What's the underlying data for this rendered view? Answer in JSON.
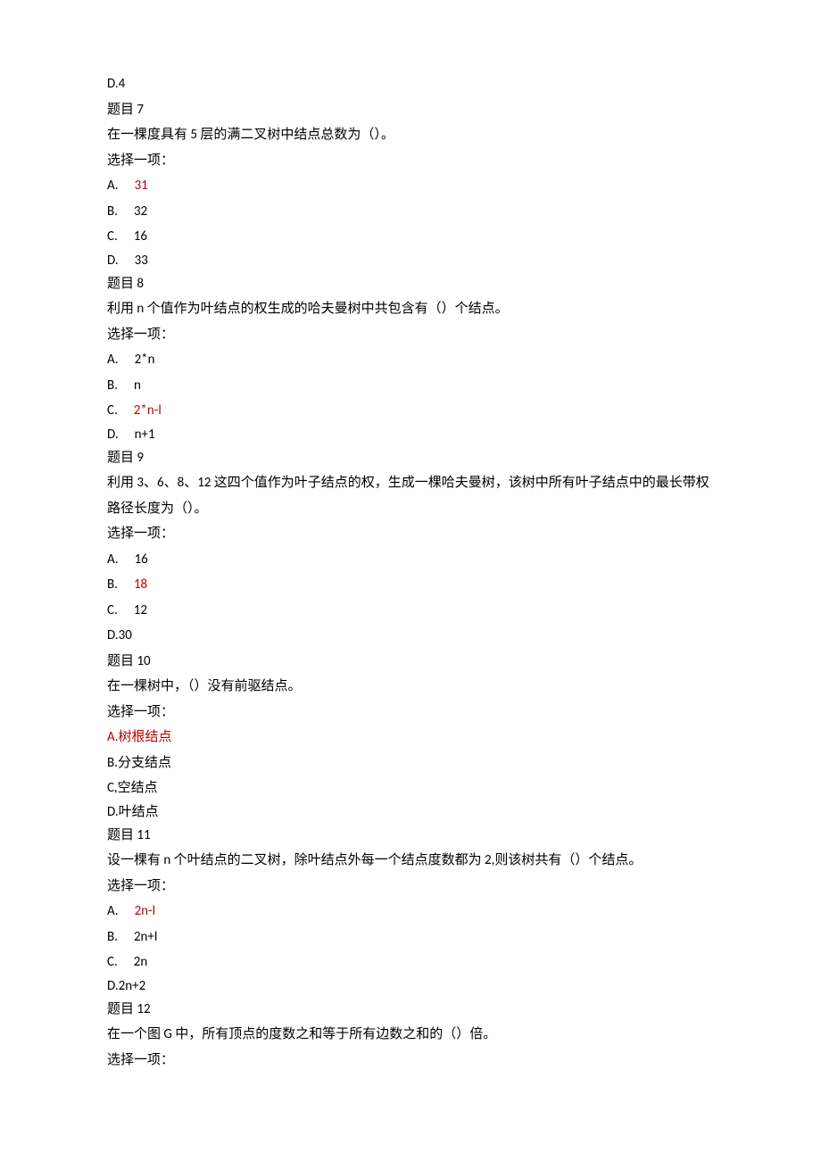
{
  "prev_option_d": "D.4",
  "questions": [
    {
      "title": "题目 7",
      "prompt": "在一棵度具有 5 层的满二叉树中结点总数为（）。",
      "choose": "选择一项：",
      "options": [
        {
          "letter": "A.",
          "text": "31",
          "answer": true,
          "spaced": true
        },
        {
          "letter": "B.",
          "text": "32",
          "answer": false,
          "spaced": true
        },
        {
          "letter": "C.",
          "text": "16",
          "answer": false,
          "spaced": true
        },
        {
          "letter": "D.",
          "text": "33",
          "answer": false,
          "spaced": true
        }
      ]
    },
    {
      "title": "题目 8",
      "prompt": "利用 n 个值作为叶结点的权生成的哈夫曼树中共包含有（）个结点。",
      "choose": "选择一项：",
      "options": [
        {
          "letter": "A.",
          "text": "2*n",
          "answer": false,
          "spaced": true
        },
        {
          "letter": "B.",
          "text": "n",
          "answer": false,
          "spaced": true
        },
        {
          "letter": "C.",
          "text": "2*n-l",
          "answer": true,
          "spaced": true
        },
        {
          "letter": "D.",
          "text": "n+1",
          "answer": false,
          "spaced": true
        }
      ]
    },
    {
      "title": "题目 9",
      "prompt": "利用 3、6、8、12 这四个值作为叶子结点的权，生成一棵哈夫曼树，该树中所有叶子结点中的最长带权路径长度为（）。",
      "choose": "选择一项：",
      "options": [
        {
          "letter": "A.",
          "text": "16",
          "answer": false,
          "spaced": true
        },
        {
          "letter": "B.",
          "text": "18",
          "answer": true,
          "spaced": true
        },
        {
          "letter": "C.",
          "text": "12",
          "answer": false,
          "spaced": true
        },
        {
          "letter": "D.30",
          "text": "",
          "answer": false,
          "spaced": false
        }
      ]
    },
    {
      "title": "题目 10",
      "prompt": "在一棵树中，（）没有前驱结点。",
      "choose": "选择一项：",
      "options": [
        {
          "letter": "A.树根结点",
          "text": "",
          "answer": true,
          "spaced": false
        },
        {
          "letter": "B.分支结点",
          "text": "",
          "answer": false,
          "spaced": false
        },
        {
          "letter": "C,空结点",
          "text": "",
          "answer": false,
          "spaced": false
        },
        {
          "letter": "D.叶结点",
          "text": "",
          "answer": false,
          "spaced": false
        }
      ]
    },
    {
      "title": "题目 11",
      "prompt": "设一棵有 n 个叶结点的二叉树，除叶结点外每一个结点度数都为 2,则该树共有（）个结点。",
      "choose": "选择一项：",
      "options": [
        {
          "letter": "A.",
          "text": "2n-l",
          "answer": true,
          "spaced": true
        },
        {
          "letter": "B.",
          "text": "2n+l",
          "answer": false,
          "spaced": true
        },
        {
          "letter": "C.",
          "text": "2n",
          "answer": false,
          "spaced": true
        },
        {
          "letter": "D.2n+2",
          "text": "",
          "answer": false,
          "spaced": false
        }
      ]
    },
    {
      "title": "题目 12",
      "prompt": "在一个图 G 中，所有顶点的度数之和等于所有边数之和的（）倍。",
      "choose": "选择一项：",
      "options": []
    }
  ]
}
